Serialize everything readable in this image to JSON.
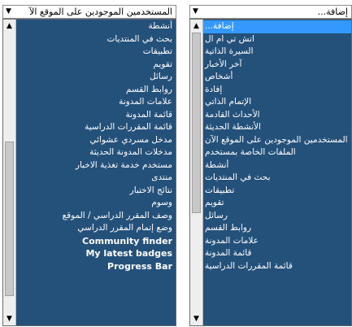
{
  "left_dropdown": {
    "selected": "المستخدمين الموجودين على الموقع الآ",
    "arrow_icon": "triangle-down",
    "items": [
      "أنشطة",
      "بحث في المنتديات",
      "تطبيقات",
      "تقويم",
      "رسائل",
      "روابط القسم",
      "علامات المدونة",
      "قائمة المدونة",
      "قائمة المقررات الدراسية",
      "مدخل مسردي عشوائي",
      "مدخلات المدونة الحديثة",
      "مستخدم خدمة تغذية الاخبار",
      "منتدى",
      "نتائج الاختبار",
      "وسوم",
      "وصف المقرر الدراسي / الموقع",
      "وضع إتمام المقرر الدراسي",
      "Community finder",
      "My latest badges",
      "Progress Bar"
    ]
  },
  "right_dropdown": {
    "selected": "إضافة...",
    "arrow_icon": "triangle-down",
    "items": [
      "إضافة...",
      "اتش تي ام ال",
      "السيرة الذاتية",
      "آخر الأخبار",
      "أشخاص",
      "إفادة",
      "الإتمام الذاتي",
      "الأحداث القادمة",
      "الأنشطة الحديثة",
      "المستخدمين الموجودين على الموقع الآن",
      "الملفات الخاصة بمستخدم",
      "أنشطة",
      "بحث في المنتديات",
      "تطبيقات",
      "تقويم",
      "رسائل",
      "روابط القسم",
      "علامات المدونة",
      "قائمة المدونة",
      "قائمة المقررات الدراسية"
    ]
  }
}
